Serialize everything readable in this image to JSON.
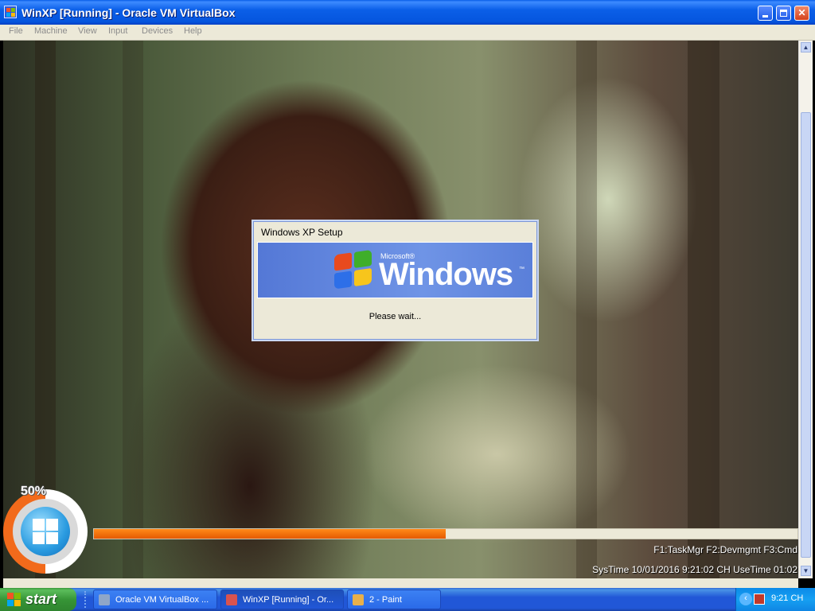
{
  "window": {
    "title": "WinXP [Running] - Oracle VM VirtualBox",
    "icon": "virtualbox-vm-icon",
    "buttons": [
      "minimize-icon",
      "maximize-icon",
      "close-icon"
    ]
  },
  "menubar": {
    "items": [
      "File",
      "Machine",
      "View",
      "Input",
      "Devices",
      "Help"
    ]
  },
  "dialog": {
    "title": "Windows XP Setup",
    "brand_small": "Microsoft®",
    "brand": "Windows",
    "tm": "™",
    "message": "Please wait..."
  },
  "progress": {
    "percent": 50,
    "label": "50%",
    "fill_color": "#f26a1b"
  },
  "status": {
    "fkeys": "F1:TaskMgr  F2:Devmgmt  F3:Cmd",
    "systime": "SysTime 10/01/2016 9:21:02 CH   UseTime 01:02"
  },
  "taskbar": {
    "start_label": "start",
    "tasks": [
      {
        "label": "Oracle VM VirtualBox ...",
        "icon": "virtualbox-icon",
        "active": false
      },
      {
        "label": "WinXP [Running] - Or...",
        "icon": "vm-window-icon",
        "active": true
      },
      {
        "label": "2 - Paint",
        "icon": "paint-icon",
        "active": false
      }
    ],
    "clock": "9:21 CH"
  },
  "colors": {
    "titlebar": "#0b5fe8",
    "start_green": "#379537",
    "progress": "#f26a1b"
  }
}
